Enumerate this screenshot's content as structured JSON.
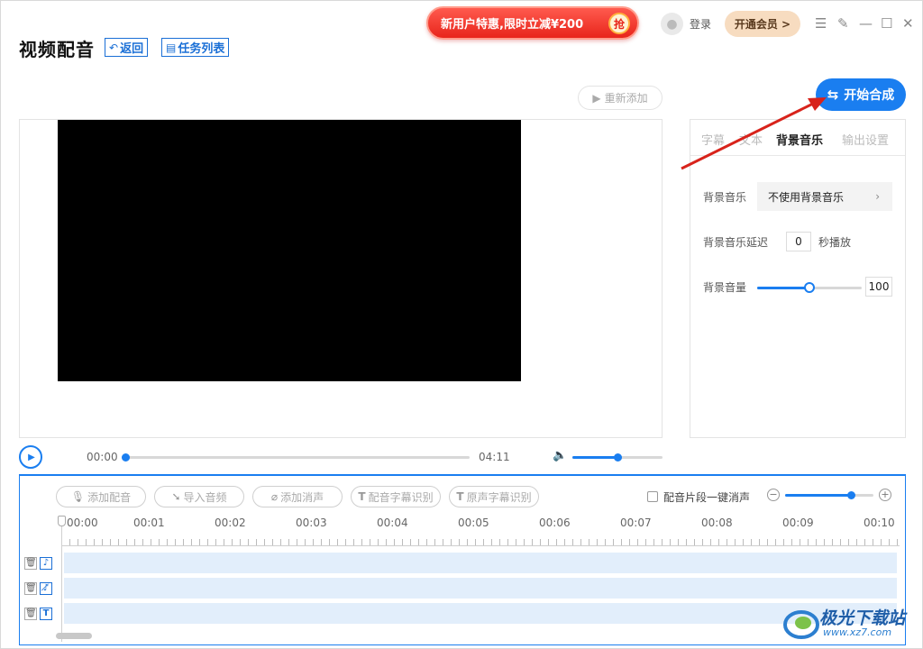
{
  "header": {
    "title": "视频配音",
    "back_label": "返回",
    "tasks_label": "任务列表",
    "promo_text": "新用户特惠,限时立减¥200",
    "promo_badge": "抢",
    "login_label": "登录",
    "vip_label": "开通会员 >"
  },
  "toolbar": {
    "readd_label": "重新添加",
    "start_label": "开始合成"
  },
  "panel": {
    "tabs": [
      "字幕",
      "文本",
      "背景音乐",
      "输出设置"
    ],
    "active_tab": "背景音乐",
    "bgm_label": "背景音乐",
    "bgm_value": "不使用背景音乐",
    "delay_label": "背景音乐延迟",
    "delay_value": "0",
    "delay_unit": "秒播放",
    "volume_label": "背景音量",
    "volume_value": "100",
    "volume_level": 0.5
  },
  "player": {
    "current_time": "00:00",
    "total_time": "04:11",
    "progress": 0.0,
    "volume_level": 0.5
  },
  "editor": {
    "tools": [
      "添加配音",
      "导入音频",
      "添加消声",
      "配音字幕识别",
      "原声字幕识别"
    ],
    "one_click_mute_label": "配音片段一键消声",
    "one_click_mute_checked": false,
    "zoom_level": 0.75,
    "ruler_labels": [
      "00:00",
      "00:01",
      "00:02",
      "00:03",
      "00:04",
      "00:05",
      "00:06",
      "00:07",
      "00:08",
      "00:09",
      "00:10"
    ],
    "tracks": [
      {
        "type": "music",
        "icon": "music-note-icon"
      },
      {
        "type": "muted-music",
        "icon": "music-mute-icon"
      },
      {
        "type": "text",
        "icon": "text-icon"
      }
    ]
  },
  "watermark": {
    "text": "极光下载站",
    "url": "www.xz7.com"
  },
  "colors": {
    "accent": "#1a7ef0",
    "promo": "#e8251b",
    "track": "#e2eefb",
    "arrow": "#d8231b"
  }
}
